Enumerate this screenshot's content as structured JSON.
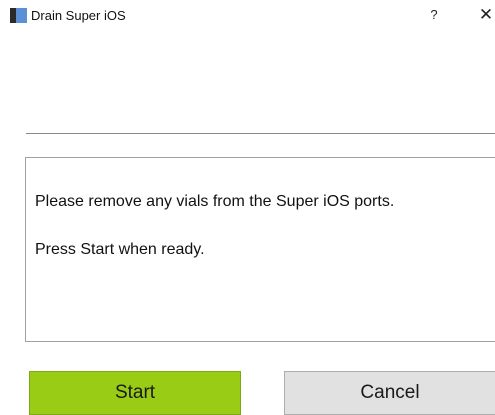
{
  "window": {
    "title": "Drain Super iOS",
    "help_label": "?",
    "close_label": "✕"
  },
  "message": {
    "line1": "Please remove any vials from the Super iOS ports.",
    "line2": "Press Start when ready."
  },
  "buttons": {
    "start_label": "Start",
    "cancel_label": "Cancel"
  },
  "colors": {
    "start_button": "#99cc14",
    "cancel_button": "#e1e1e1"
  },
  "icons": {
    "app": "app-icon",
    "help": "help-icon",
    "close": "close-icon"
  }
}
